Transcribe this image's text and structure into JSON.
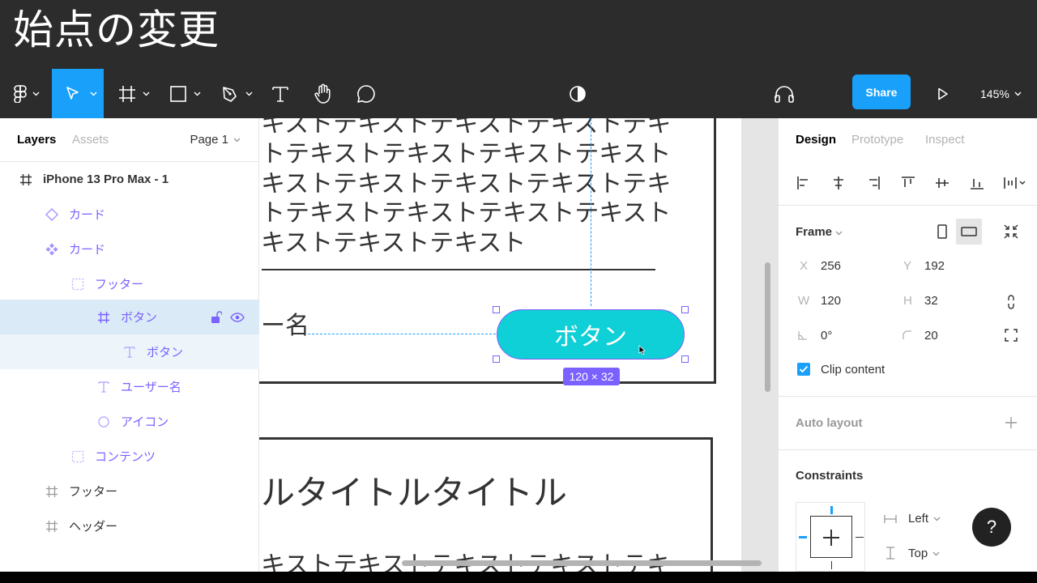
{
  "slide_title": "始点の変更",
  "toolbar": {
    "share_label": "Share",
    "zoom_label": "145%"
  },
  "left_panel": {
    "tab_layers": "Layers",
    "tab_assets": "Assets",
    "page_label": "Page 1",
    "layers": [
      {
        "label": "iPhone 13 Pro Max - 1",
        "icon": "frame-icon"
      },
      {
        "label": "カード",
        "icon": "component-outline-icon"
      },
      {
        "label": "カード",
        "icon": "component-icon"
      },
      {
        "label": "フッター",
        "icon": "autolayout-icon"
      },
      {
        "label": "ボタン",
        "icon": "frame-icon"
      },
      {
        "label": "ボタン",
        "icon": "text-icon"
      },
      {
        "label": "ユーザー名",
        "icon": "text-icon"
      },
      {
        "label": "アイコン",
        "icon": "ellipse-icon"
      },
      {
        "label": "コンテンツ",
        "icon": "autolayout-icon"
      },
      {
        "label": "フッター",
        "icon": "frame-icon"
      },
      {
        "label": "ヘッダー",
        "icon": "frame-icon"
      }
    ]
  },
  "canvas": {
    "text_lines": [
      "キストテキストテキストテキストテキ",
      "トテキストテキストテキストテキスト",
      "キストテキストテキストテキストテキ",
      "トテキストテキストテキストテキスト",
      "キストテキストテキスト"
    ],
    "username_fragment": "ー名",
    "button_text": "ボタン",
    "size_badge": "120 × 32",
    "card2_title": "ルタイトルタイトル",
    "card2_text": "キストテキストテキストテキストテキ"
  },
  "right_panel": {
    "tab_design": "Design",
    "tab_prototype": "Prototype",
    "tab_inspect": "Inspect",
    "frame_label": "Frame",
    "x_label": "X",
    "x_value": "256",
    "y_label": "Y",
    "y_value": "192",
    "w_label": "W",
    "w_value": "120",
    "h_label": "H",
    "h_value": "32",
    "rotation_value": "0°",
    "radius_value": "20",
    "clip_content_label": "Clip content",
    "auto_layout_label": "Auto layout",
    "constraints_label": "Constraints",
    "constraint_h": "Left",
    "constraint_v": "Top"
  },
  "help_label": "?",
  "colors": {
    "accent": "#18a0fb",
    "selection": "#7b61ff",
    "button_fill": "#0fcfd7",
    "toolbar_bg": "#2c2c2c"
  }
}
